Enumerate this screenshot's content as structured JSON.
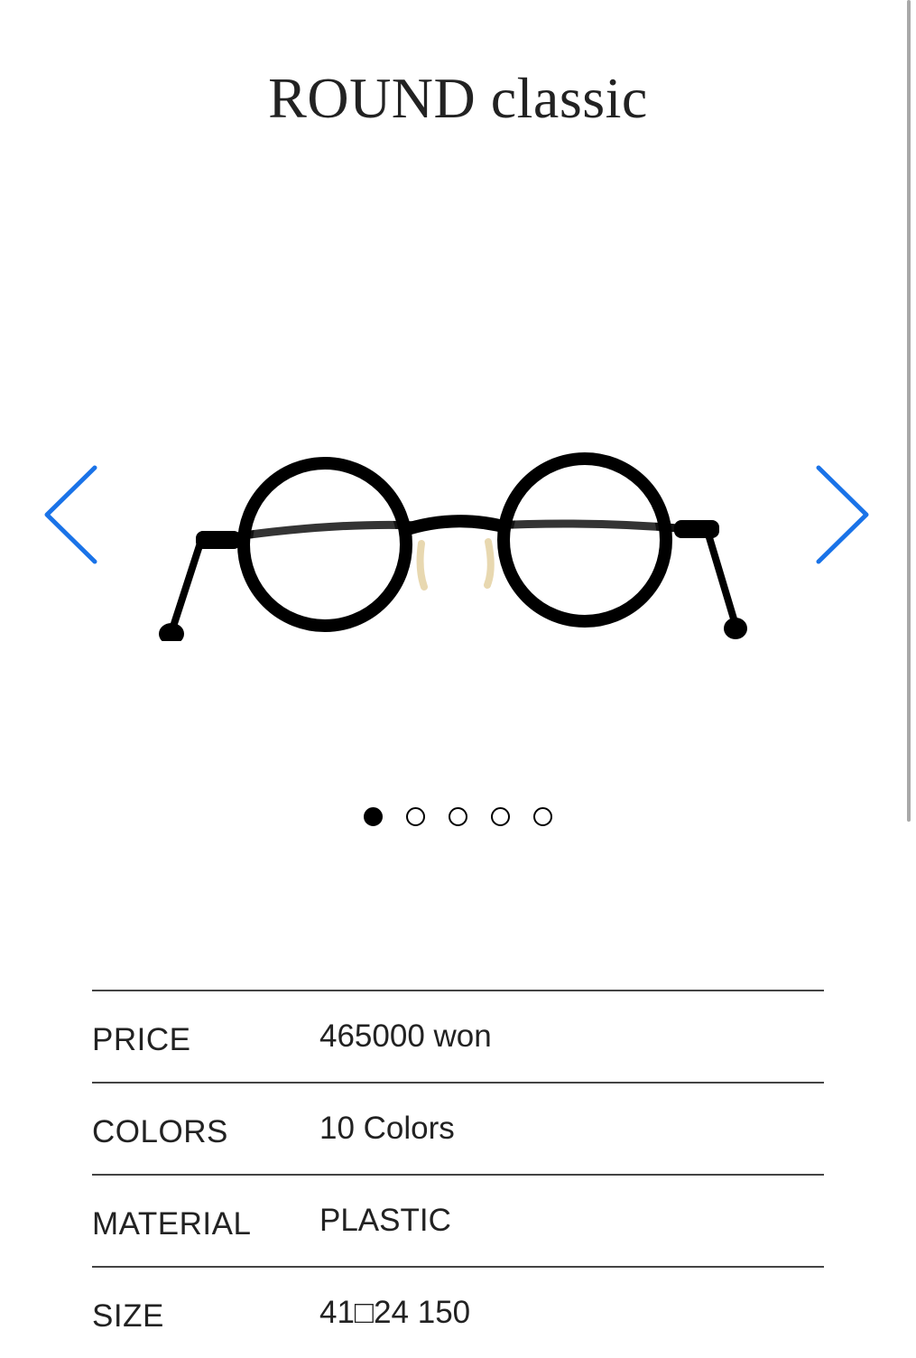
{
  "product": {
    "title": "ROUND classic"
  },
  "carousel": {
    "prev_icon": "chevron-left-icon",
    "next_icon": "chevron-right-icon",
    "accent_color": "#1a73e8",
    "slide_count": 5,
    "active_index": 0,
    "image": "round-glasses-black"
  },
  "specs": [
    {
      "label": "PRICE",
      "value": "465000 won"
    },
    {
      "label": "COLORS",
      "value": "10 Colors"
    },
    {
      "label": "MATERIAL",
      "value": "PLASTIC"
    },
    {
      "label": "SIZE",
      "value": "41□24 150"
    }
  ]
}
